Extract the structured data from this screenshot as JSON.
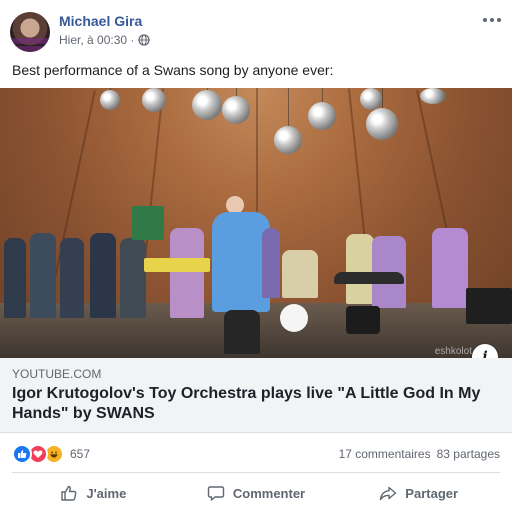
{
  "post": {
    "author": "Michael Gira",
    "timestamp": "Hier, à 00:30 ·",
    "privacy_icon": "globe-icon",
    "text": "Best performance of a Swans song by anyone ever:"
  },
  "media": {
    "watermark": "eshkolot",
    "info_icon_text": "i"
  },
  "link_preview": {
    "domain": "YOUTUBE.COM",
    "title": "Igor Krutogolov's Toy Orchestra plays live \"A Little God In My Hands\" by SWANS"
  },
  "engagement": {
    "reaction_icons": [
      "like-icon",
      "love-icon",
      "haha-icon"
    ],
    "reaction_count": "657",
    "comments": "17 commentaires",
    "shares": "83 partages"
  },
  "actions": {
    "like_label": "J'aime",
    "comment_label": "Commenter",
    "share_label": "Partager"
  },
  "colors": {
    "author_link": "#385898",
    "secondary_text": "#606770",
    "like_blue": "#1877f2",
    "love_red": "#f33e58",
    "haha_yellow": "#f7b125"
  }
}
